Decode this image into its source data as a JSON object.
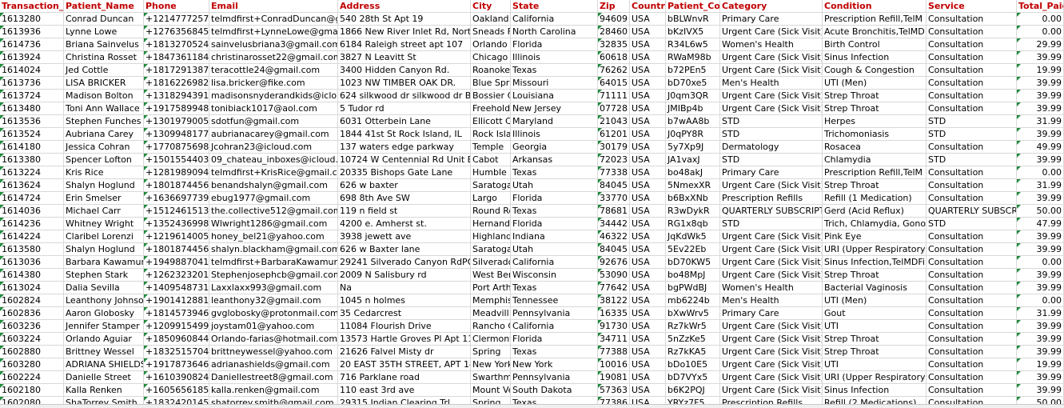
{
  "colors": {
    "header_text": "#c00000",
    "gridline": "#d9d9d9",
    "number_flag": "#1f8a3c"
  },
  "columns": [
    {
      "key": "transaction_id",
      "label": "Transaction_ID"
    },
    {
      "key": "patient_name",
      "label": "Patient_Name"
    },
    {
      "key": "phone",
      "label": "Phone"
    },
    {
      "key": "email",
      "label": "Email"
    },
    {
      "key": "address",
      "label": "Address"
    },
    {
      "key": "city",
      "label": "City"
    },
    {
      "key": "state",
      "label": "State"
    },
    {
      "key": "zip",
      "label": "Zip"
    },
    {
      "key": "country",
      "label": "Country"
    },
    {
      "key": "patient_code",
      "label": "Patient_Code"
    },
    {
      "key": "category",
      "label": "Category"
    },
    {
      "key": "condition",
      "label": "Condition"
    },
    {
      "key": "service",
      "label": "Service"
    },
    {
      "key": "total_paid",
      "label": "Total_Paid"
    }
  ],
  "rows": [
    [
      "1613280",
      "Conrad Duncan",
      "+12147772575",
      "telmdfirst+ConradDuncan@gi",
      "540 28th St Apt 19",
      "Oakland",
      "California",
      "94609",
      "USA",
      "bBLWnvR",
      "Primary Care",
      "Prescription Refill,TelM",
      "Consultation",
      "0.00"
    ],
    [
      "1613936",
      "Lynne Lowe",
      "+12763568451",
      "telmdfirst+LynneLowe@gmai",
      "1866 New River Inlet Rd, North",
      "Sneads F",
      "North Carolina",
      "28460",
      "USA",
      "bKzIVX5",
      "Urgent Care (Sick Visit)",
      "Acute Bronchitis,TelMD",
      "Consultation",
      "0.00"
    ],
    [
      "1614736",
      "Briana Sainvelus",
      "+18132705249",
      "sainvelusbriana3@gmail.com",
      "6184 Raleigh street apt 107",
      "Orlando",
      "Florida",
      "32835",
      "USA",
      "R34L6w5",
      "Women's Health",
      "Birth Control",
      "Consultation",
      "29.99"
    ],
    [
      "1613924",
      "Christina Rosset",
      "+18473611845",
      "christinarosset22@gmail.com",
      "3827 N Leavitt St",
      "Chicago",
      "Illinois",
      "60618",
      "USA",
      "RWaM98b",
      "Urgent Care (Sick Visit)",
      "Sinus Infection",
      "Consultation",
      "39.99"
    ],
    [
      "1614024",
      "Jed Cottle",
      "+18172913877",
      "teracottle24@gmail.com",
      "3400 Hidden Canyon Rd.",
      "Roanoke",
      "Texas",
      "76262",
      "USA",
      "b72PEn5",
      "Urgent Care (Sick Visit)",
      "Cough & Congestion",
      "Consultation",
      "19.99"
    ],
    [
      "1613736",
      "LISA BRICKER",
      "+18162269825",
      "lisa.bricker@fike.com",
      "1023 NW TIMBER OAK DR.",
      "Blue Spri",
      "Missouri",
      "64015",
      "USA",
      "bD70xe5",
      "Men's Health",
      "UTI (Men)",
      "Consultation",
      "39.99"
    ],
    [
      "1613724",
      "Madison Bolton",
      "+13182943912",
      "madisonsnyderandkids@iclo",
      "624 silkwood dr silkwood dr B",
      "Bossier C",
      "Louisiana",
      "71111",
      "USA",
      "J0qm3QR",
      "Urgent Care (Sick Visit)",
      "Strep Throat",
      "Consultation",
      "39.99"
    ],
    [
      "1613480",
      "Toni Ann Wallace",
      "+19175899488",
      "tonibiack1017@aol.com",
      "5 Tudor rd",
      "Freehold",
      "New Jersey",
      "07728",
      "USA",
      "JMIBp4b",
      "Urgent Care (Sick Visit)",
      "Strep Throat",
      "Consultation",
      "39.99"
    ],
    [
      "1613536",
      "Stephen Funches",
      "+13019790055",
      "sdotfun@gmail.com",
      "6031 Otterbein Lane",
      "Ellicott C",
      "Maryland",
      "21043",
      "USA",
      "b7wAA8b",
      "STD",
      "Herpes",
      "STD",
      "31.99"
    ],
    [
      "1613524",
      "Aubriana Carey",
      "+13099481773",
      "aubrianacarey@gmail.com",
      "1844 41st St  Rock Island, IL",
      "Rock Isla",
      "Illinois",
      "61201",
      "USA",
      "J0qPY8R",
      "STD",
      "Trichomoniasis",
      "STD",
      "39.99"
    ],
    [
      "1614180",
      "Jessica Cohran",
      "+17708756987",
      "Jcohran23@icloud.com",
      "137 waters edge parkway",
      "Temple",
      "Georgia",
      "30179",
      "USA",
      "5y7Xp9J",
      "Dermatology",
      "Rosacea",
      "Consultation",
      "49.99"
    ],
    [
      "1613380",
      "Spencer Lofton",
      "+15015544039",
      "09_chateau_inboxes@icloud.",
      "10724 W Centennial Rd Unit B",
      "Cabot",
      "Arkansas",
      "72023",
      "USA",
      "JA1vaxJ",
      "STD",
      "Chlamydia",
      "STD",
      "39.99"
    ],
    [
      "1613224",
      "Kris Rice",
      "+12819890941",
      "telmdfirst+KrisRice@gmail.cc",
      "20335 Bishops Gate Lane",
      "Humble",
      "Texas",
      "77338",
      "USA",
      "bo48akJ",
      "Primary Care",
      "Prescription Refill,TelM",
      "Consultation",
      "0.00"
    ],
    [
      "1613624",
      "Shalyn Hoglund",
      "+18018744567",
      "benandshalyn@gmail.com",
      "626 w baxter",
      "Saratoga",
      "Utah",
      "84045",
      "USA",
      "5NmexXR",
      "Urgent Care (Sick Visit)",
      "Strep Throat",
      "Consultation",
      "31.99"
    ],
    [
      "1614724",
      "Erin Smelser",
      "+16366977393",
      "ebug1977@gmail.com",
      "698 8th Ave SW",
      "Largo",
      "Florida",
      "33770",
      "USA",
      "b6BxXNb",
      "Prescription Refills",
      "Refill (1 Medication)",
      "Consultation",
      "39.99"
    ],
    [
      "1614036",
      "Michael Carr",
      "+15124615136",
      "the.collective512@gmail.com",
      "119 n field st",
      "Round Ro",
      "Texas",
      "78681",
      "USA",
      "R3wDykR",
      "QUARTERLY SUBSCRIPTI",
      "Gerd (Acid Reflux)",
      "QUARTERLY SUBSCRIP",
      "50.00"
    ],
    [
      "1614236",
      "Whitney Wright",
      "+13524369987",
      "Wlwright1286@gmail.com",
      "4200 e. Amherst st.",
      "Hernando",
      "Florida",
      "34442",
      "USA",
      "RG1x8qb",
      "STD",
      "Trich, Chlamydia, Gonor",
      "STD",
      "47.99"
    ],
    [
      "1614224",
      "Claribel Lorenzi",
      "+12196140056",
      "honey_bel21@yahoo.com",
      "3938 jewett ave",
      "Highland",
      "Indiana",
      "46322",
      "USA",
      "JqKdWk5",
      "Urgent Care (Sick Visit)",
      "Pink Eye",
      "Consultation",
      "39.99"
    ],
    [
      "1613580",
      "Shalyn Hoglund",
      "+18018744567",
      "shalyn.blackham@gmail.com",
      "626 w Baxter lane",
      "Saratoga",
      "Utah",
      "84045",
      "USA",
      "5Ev22Eb",
      "Urgent Care (Sick Visit)",
      "URI (Upper Respiratory)",
      "Consultation",
      "39.99"
    ],
    [
      "1613036",
      "Barbara Kawamur",
      "+19498870411",
      "telmdfirst+BarbaraKawamura",
      "29241 Silverado Canyon RdPOB",
      "Silverado",
      "California",
      "92676",
      "USA",
      "bD70KW5",
      "Urgent Care (Sick Visit)",
      "Sinus Infection,TelMDFi",
      "Consultation",
      "0.00"
    ],
    [
      "1614380",
      "Stephen Stark",
      "+12623232012",
      "Stephenjosephcb@gmail.com",
      "2009 N Salisbury rd",
      "West Ben",
      "Wisconsin",
      "53090",
      "USA",
      "bo48MpJ",
      "Urgent Care (Sick Visit)",
      "Strep Throat",
      "Consultation",
      "39.99"
    ],
    [
      "1613024",
      "Dalia Sevilla",
      "+14095487312",
      "Laxxlaxx993@gmail.com",
      "Na",
      "Port Arth",
      "Texas",
      "77642",
      "USA",
      "bgPWdBJ",
      "Women's Health",
      "Bacterial Vaginosis",
      "Consultation",
      "39.99"
    ],
    [
      "1602824",
      "Leanthony Johnso",
      "+19014128817",
      "leanthony32@gmail.com",
      "1045 n holmes",
      "Memphis",
      "Tennessee",
      "38122",
      "USA",
      "mb6224b",
      "Men's Health",
      "UTI (Men)",
      "Consultation",
      "0.00"
    ],
    [
      "1602836",
      "Aaron Globosky",
      "+18145739466",
      "gvglobosky@protonmail.com",
      "35 Cedarcrest",
      "Meadvill",
      "Pennsylvania",
      "16335",
      "USA",
      "bXwWrv5",
      "Primary Care",
      "Gout",
      "Consultation",
      "31.99"
    ],
    [
      "1603236",
      "Jennifer Stamper",
      "+12099154999",
      "joystam01@yahoo.com",
      "11084 Flourish Drive",
      "Rancho C",
      "California",
      "91730",
      "USA",
      "Rz7kWr5",
      "Urgent Care (Sick Visit)",
      "UTI",
      "Consultation",
      "39.99"
    ],
    [
      "1603224",
      "Orlando Aguiar",
      "+18509608449",
      "Orlando-farias@hotmail.com",
      "13573 Hartle Groves Pl Apt 110",
      "Clermont",
      "Florida",
      "34711",
      "USA",
      "5nZzKe5",
      "Urgent Care (Sick Visit)",
      "Strep Throat",
      "Consultation",
      "39.99"
    ],
    [
      "1602880",
      "Brittney Wessel",
      "+18325157044",
      "brittneywessel@yahoo.com",
      "21626 Falvel Misty dr",
      "Spring",
      "Texas",
      "77388",
      "USA",
      "Rz7kKA5",
      "Urgent Care (Sick Visit)",
      "Strep Throat",
      "Consultation",
      "39.99"
    ],
    [
      "1603280",
      "ADRIANA SHIELDS",
      "+19178736468",
      "adrianashields@gmail.com",
      "20 EAST 35TH STREET, APT 14M",
      "New York",
      "New York",
      "10016",
      "USA",
      "bDo10E5",
      "Urgent Care (Sick Visit)",
      "UTI",
      "Consultation",
      "19.99"
    ],
    [
      "1602224",
      "Danielle Street",
      "+16103908242",
      "Daniellestreet8@gmail.com",
      "716 Parklane road",
      "Swarthm",
      "Pennsylvania",
      "19081",
      "USA",
      "bD7VYx5",
      "Urgent Care (Sick Visit)",
      "URI (Upper Respiratory)",
      "Consultation",
      "39.99"
    ],
    [
      "1602180",
      "Kalla Renken",
      "+16056561852",
      "kalla.renken@gmail.com",
      "110 east 3rd ave",
      "Mount Ve",
      "South Dakota",
      "57363",
      "USA",
      "b6K2PQJ",
      "Urgent Care (Sick Visit)",
      "Sinus Infection",
      "Consultation",
      "39.99"
    ],
    [
      "1602080",
      "ShaTorrey Smith",
      "+18324201458",
      "shatorrey.smith@gmail.com",
      "29315 Indian Clearing Trl",
      "Spring",
      "Texas",
      "77386",
      "USA",
      "YRYz7F5",
      "Prescription Refills",
      "Refill (2 Medications)",
      "Consultation",
      "50.00"
    ]
  ]
}
